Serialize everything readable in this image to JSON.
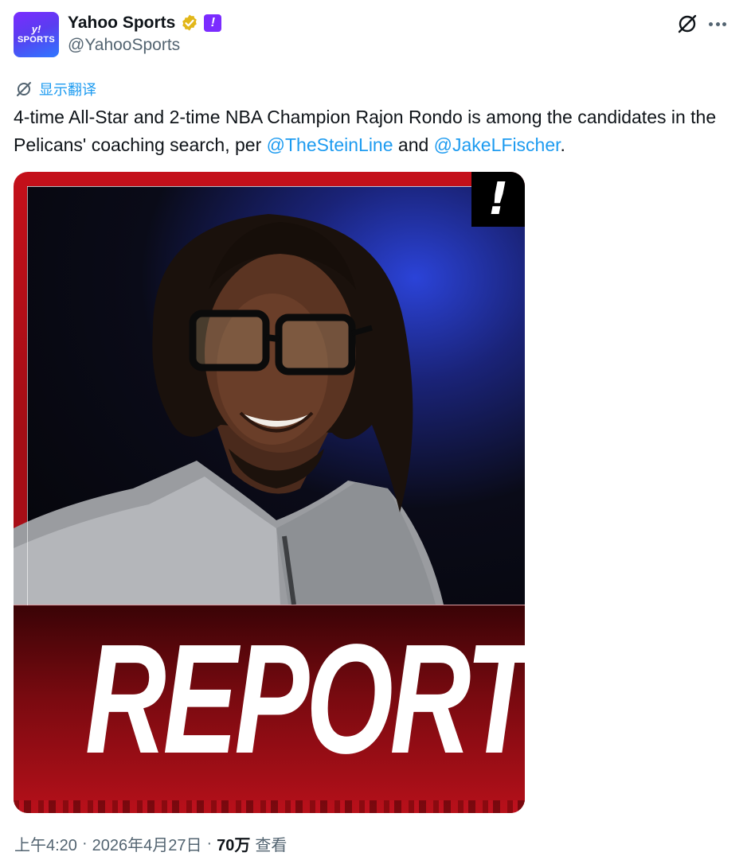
{
  "author": {
    "display_name": "Yahoo Sports",
    "handle": "@YahooSports",
    "avatar": {
      "mark": "y!",
      "word": "SPORTS"
    },
    "verified_badge_color": "#e2b719",
    "affiliate_badge": {
      "glyph": "!",
      "color": "#7b2cff"
    }
  },
  "header_actions": {
    "grok_icon": "grok-icon",
    "more_icon": "more-options-icon"
  },
  "translate": {
    "label": "显示翻译",
    "icon": "translate-icon"
  },
  "tweet": {
    "text_prefix": "4-time All-Star and 2-time NBA Champion Rajon Rondo is among the candidates in the Pelicans' coaching search, per ",
    "mention_1": "@TheSteinLine",
    "connector": " and ",
    "mention_2": "@JakeLFischer",
    "suffix": "."
  },
  "media": {
    "badge": "!",
    "headline": "REPORT",
    "accent_color": "#c4101a"
  },
  "meta": {
    "time": "上午4:20",
    "separator": "·",
    "date": "2026年4月27日",
    "views_count": "70万",
    "views_label": "查看"
  }
}
